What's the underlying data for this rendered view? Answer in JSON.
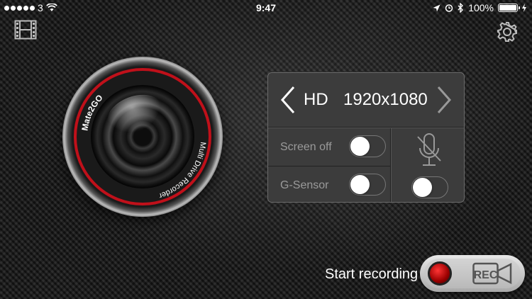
{
  "status_bar": {
    "carrier": "3",
    "time": "9:47",
    "battery": "100%"
  },
  "lens": {
    "brand": "Mate2GO",
    "subtitle": "Multi Drive Recorder"
  },
  "resolution": {
    "quality": "HD",
    "size": "1920x1080"
  },
  "options": {
    "screen_off": {
      "label": "Screen off",
      "on": false
    },
    "g_sensor": {
      "label": "G-Sensor",
      "on": false
    },
    "microphone": {
      "on": false
    }
  },
  "record": {
    "label": "Start recording",
    "cam_text": "REC"
  },
  "colors": {
    "accent_red": "#c0101a",
    "panel_bg": "#3c3c3c"
  },
  "icons": [
    "film-icon",
    "gear-icon",
    "mic-off-icon",
    "rec-camera-icon",
    "location-icon",
    "alarm-icon",
    "bluetooth-icon",
    "wifi-icon",
    "battery-icon"
  ]
}
